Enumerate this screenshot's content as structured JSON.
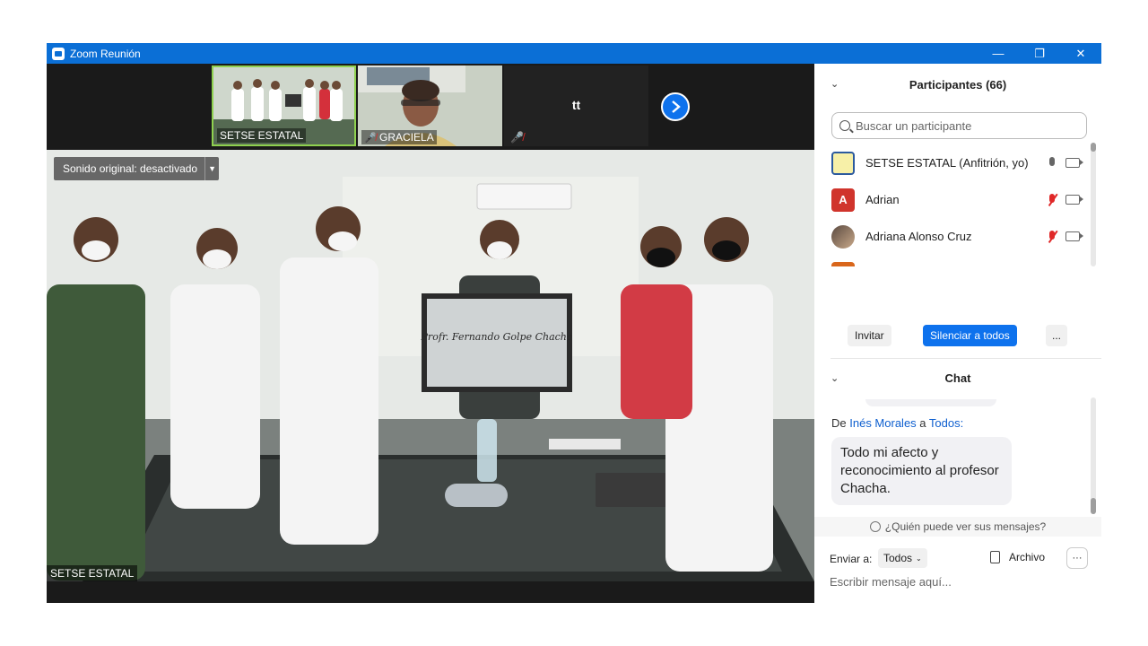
{
  "window": {
    "title": "Zoom Reunión",
    "controls": [
      "—",
      "❐",
      "✕"
    ]
  },
  "gallery": {
    "thumbnails": [
      {
        "name": "SETSE ESTATAL"
      },
      {
        "name": "GRACIELA"
      },
      {
        "name": "tt"
      }
    ]
  },
  "main_video": {
    "sound_label": "Sonido original: desactivado",
    "speaker_name": "SETSE ESTATAL",
    "plaque_heading": "Profr. Fernando Golpe Chacha"
  },
  "participants": {
    "title": "Participantes (66)",
    "search_placeholder": "Buscar un participante",
    "items": [
      {
        "name": "SETSE ESTATAL (Anfitrión, yo)",
        "initial": "",
        "muted": false
      },
      {
        "name": "Adrian",
        "initial": "A",
        "muted": true
      },
      {
        "name": "Adriana Alonso Cruz",
        "initial": "",
        "muted": true
      },
      {
        "name": "",
        "initial": "",
        "muted": true
      }
    ],
    "invite_label": "Invitar",
    "mute_all_label": "Silenciar a todos",
    "more_label": "..."
  },
  "chat": {
    "title": "Chat",
    "from_prefix": "De",
    "sender": "Inés Morales",
    "to_word": "a",
    "recipient": "Todos:",
    "message": "Todo mi afecto y reconocimiento al profesor Chacha.",
    "who_can_see": "¿Quién puede ver sus mensajes?",
    "send_to_label": "Enviar a:",
    "send_to_value": "Todos",
    "file_label": "Archivo",
    "more_label": "···",
    "input_placeholder": "Escribir mensaje aquí..."
  },
  "colors": {
    "zoom_blue": "#0e72ed",
    "titlebar": "#0b6fd6",
    "mute_red": "#e02828"
  }
}
